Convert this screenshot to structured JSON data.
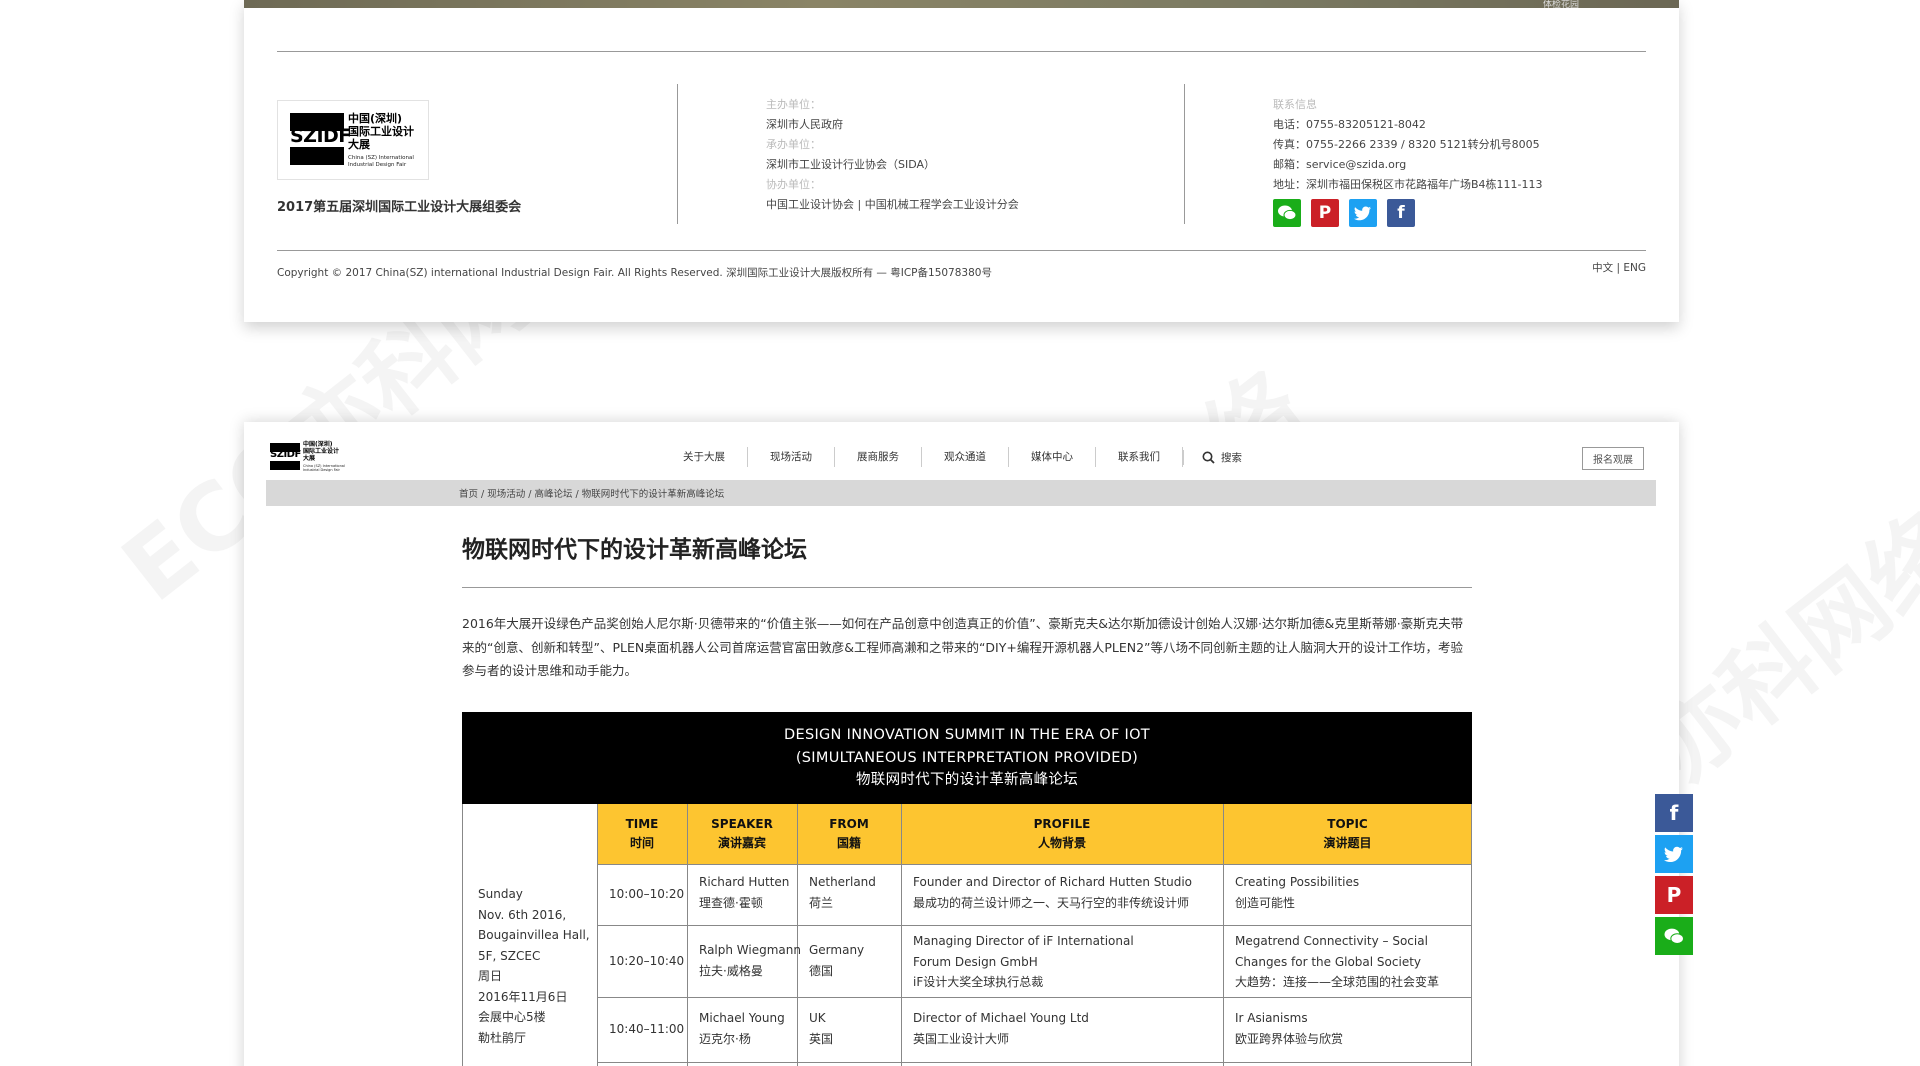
{
  "footer": {
    "map_label": "体检花园",
    "logo": {
      "wordmark": "SZIDF",
      "cn_lines": [
        "中国(深圳)",
        "国际工业设计",
        "大展"
      ],
      "en_lines": [
        "China (SZ) International",
        "Industrial Design Fair"
      ]
    },
    "org_title": "2017第五届深圳国际工业设计大展组委会",
    "organizers": {
      "host_label": "主办单位：",
      "host_value": "深圳市人民政府",
      "undertake_label": "承办单位：",
      "undertake_value": "深圳市工业设计行业协会（SIDA）",
      "cohost_label": "协办单位：",
      "cohost_value": "中国工业设计协会 | 中国机械工程学会工业设计分会"
    },
    "contact": {
      "heading": "联系信息",
      "phone": "电话：0755-83205121-8042",
      "fax": "传真：0755-2266 2339 / 8320 5121转分机号8005",
      "email": "邮箱：service@szida.org",
      "address": "地址：深圳市福田保税区市花路福年广场B4栋111-113"
    },
    "copyright": "Copyright © 2017 China(SZ) international Industrial Design Fair. All Rights Reserved. 深圳国际工业设计大展版权所有  —  粤ICP备15078380号",
    "lang": "中文  |  ENG"
  },
  "colors": {
    "wechat": "#1aad19",
    "pinterest": "#cb2027",
    "twitter": "#1da1f2",
    "facebook": "#3b5998",
    "accent_yellow": "#fdc530"
  },
  "nav": {
    "items": [
      "关于大展",
      "现场活动",
      "展商服务",
      "观众通道",
      "媒体中心",
      "联系我们"
    ],
    "search_label": "搜索",
    "register_label": "报名观展"
  },
  "breadcrumb": "首页  /  现场活动  /  高峰论坛  /  物联网时代下的设计革新高峰论坛",
  "article": {
    "title": "物联网时代下的设计革新高峰论坛",
    "intro": "2016年大展开设绿色产品奖创始人尼尔斯·贝德带来的“价值主张——如何在产品创意中创造真正的价值”、豪斯克夫&达尔斯加德设计创始人汉娜·达尔斯加德&克里斯蒂娜·豪斯克夫带来的“创意、创新和转型”、PLEN桌面机器人公司首席运营官富田敦彦&工程师高濑和之带来的“DIY+编程开源机器人PLEN2”等八场不同创新主题的让人脑洞大开的设计工作坊，考验参与者的设计思维和动手能力。"
  },
  "schedule": {
    "head": [
      "DESIGN INNOVATION SUMMIT IN THE ERA OF IOT",
      "(SIMULTANEOUS INTERPRETATION PROVIDED)",
      "物联网时代下的设计革新高峰论坛"
    ],
    "columns": [
      {
        "en": "TIME",
        "cn": "时间"
      },
      {
        "en": "SPEAKER",
        "cn": "演讲嘉宾"
      },
      {
        "en": "FROM",
        "cn": "国籍"
      },
      {
        "en": "PROFILE",
        "cn": "人物背景"
      },
      {
        "en": "TOPIC",
        "cn": "演讲题目"
      }
    ],
    "venue": [
      "Sunday",
      "Nov. 6th 2016,",
      "Bougainvillea Hall,",
      "5F, SZCEC",
      "周日",
      "2016年11月6日",
      "会展中心5楼",
      "勒杜鹃厅"
    ],
    "rows": [
      {
        "time": "10:00–10:20",
        "speaker": [
          "Richard Hutten",
          "理查德·霍顿"
        ],
        "from": [
          "Netherland",
          "荷兰"
        ],
        "profile": [
          "Founder and Director of Richard Hutten Studio",
          "最成功的荷兰设计师之一、天马行空的非传统设计师"
        ],
        "topic": [
          "Creating Possibilities",
          "创造可能性"
        ]
      },
      {
        "time": "10:20–10:40",
        "speaker": [
          "Ralph Wiegmann",
          "拉夫·威格曼"
        ],
        "from": [
          "Germany",
          "德国"
        ],
        "profile": [
          "Managing Director of iF International",
          "Forum Design GmbH",
          " iF设计大奖全球执行总裁"
        ],
        "topic": [
          "Megatrend Connectivity – Social",
          "Changes for the Global Society",
          "大趋势：连接——全球范围的社会变革"
        ]
      },
      {
        "time": "10:40–11:00",
        "speaker": [
          "Michael Young",
          "迈克尔·杨"
        ],
        "from": [
          "UK",
          "英国"
        ],
        "profile": [
          "Director of Michael Young Ltd",
          "英国工业设计大师"
        ],
        "topic": [
          "Ir Asianisms",
          "欧亚跨界体验与欣赏"
        ]
      }
    ]
  },
  "share_bar": [
    "facebook-icon",
    "twitter-icon",
    "pinterest-icon",
    "wechat-icon"
  ],
  "watermark": "ECO亦科网络"
}
